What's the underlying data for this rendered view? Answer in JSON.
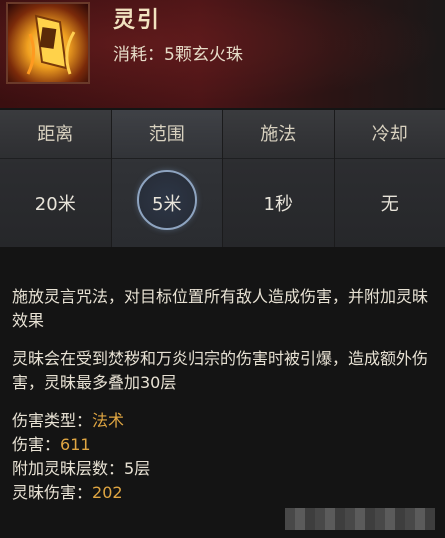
{
  "skill": {
    "name": "灵引",
    "cost": "消耗：5颗玄火珠",
    "icon": "flame-scroll-icon"
  },
  "stats": [
    {
      "label": "距离",
      "value": "20米"
    },
    {
      "label": "范围",
      "value": "5米"
    },
    {
      "label": "施法",
      "value": "1秒"
    },
    {
      "label": "冷却",
      "value": "无"
    }
  ],
  "description": {
    "p1": "施放灵言咒法，对目标位置所有敌人造成伤害，并附加灵昧效果",
    "p2": "灵昧会在受到焚秽和万炎归宗的伤害时被引爆，造成额外伤害，灵昧最多叠加30层",
    "props": [
      {
        "label": "伤害类型：",
        "value": "法术"
      },
      {
        "label": "伤害：",
        "value": "611"
      },
      {
        "label": "附加灵昧层数：",
        "value": "5层"
      },
      {
        "label": "灵昧伤害：",
        "value": "202"
      }
    ]
  },
  "colors": {
    "accent": "#e0a642",
    "header": "#4a1416",
    "panel": "#2a2b2d"
  }
}
